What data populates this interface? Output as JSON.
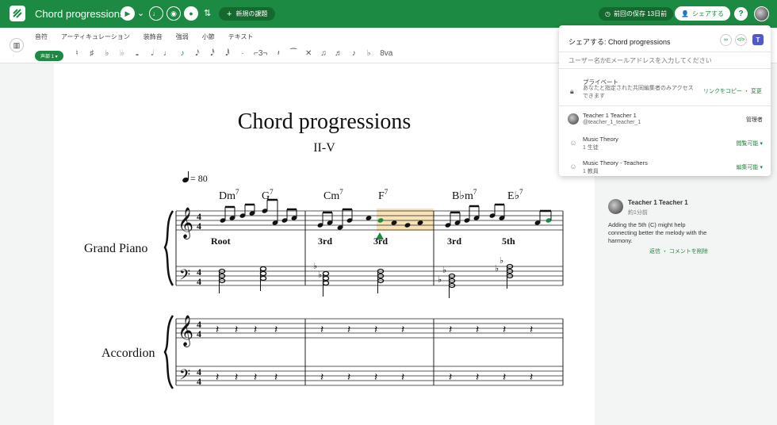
{
  "app": {
    "doc_title": "Chord progressions",
    "new_task_label": "新規の課題",
    "last_saved_label": "前回の保存 13日前",
    "share_label": "シェアする",
    "help_label": "?"
  },
  "toolbar": {
    "tabs": [
      "音符",
      "アーティキュレーション",
      "装飾音",
      "強弱",
      "小節",
      "テキスト"
    ],
    "voice_label": "声部 1 ▾"
  },
  "score": {
    "title": "Chord progressions",
    "subtitle": "II-V",
    "tempo": "= 80",
    "instruments": [
      "Grand Piano",
      "Accordion"
    ],
    "chord_symbols": [
      {
        "root": "D",
        "acc": "m",
        "ext": "7"
      },
      {
        "root": "G",
        "acc": "",
        "ext": "7"
      },
      {
        "root": "C",
        "acc": "m",
        "ext": "7"
      },
      {
        "root": "F",
        "acc": "",
        "ext": "7"
      },
      {
        "root": "B",
        "acc": "♭m",
        "ext": "7"
      },
      {
        "root": "E",
        "acc": "♭",
        "ext": "7"
      }
    ],
    "lyrics": [
      "Root",
      "3rd",
      "3rd",
      "3rd",
      "5th"
    ],
    "time_signature": {
      "top": "4",
      "bottom": "4"
    }
  },
  "share_panel": {
    "title": "シェアする: Chord progressions",
    "search_placeholder": "ユーザー名かEメールアドレスを入力してください",
    "privacy_label": "プライベート",
    "privacy_desc": "あなたと指定された共同編集者のみアクセスできます",
    "privacy_link": "リンクをコピー ・ 変更",
    "members": [
      {
        "name": "Teacher 1 Teacher 1",
        "sub": "@teacher_1_teacher_1",
        "role": "管理者",
        "icon": "user-avatar"
      },
      {
        "name": "Music Theory",
        "sub": "1 生徒",
        "role": "閲覧可能 ▾",
        "icon": "group-icon"
      },
      {
        "name": "Music Theory - Teachers",
        "sub": "1 教員",
        "role": "編集可能 ▾",
        "icon": "group-icon"
      }
    ]
  },
  "comment": {
    "author": "Teacher 1 Teacher 1",
    "time": "約1分前",
    "text": "Adding the 5th (C) might help connecting better the melody with the harmony.",
    "actions": "返信 ・ コメントを削除"
  },
  "colors": {
    "brand_green": "#1d8a43",
    "highlight": "#f7e3b5"
  }
}
